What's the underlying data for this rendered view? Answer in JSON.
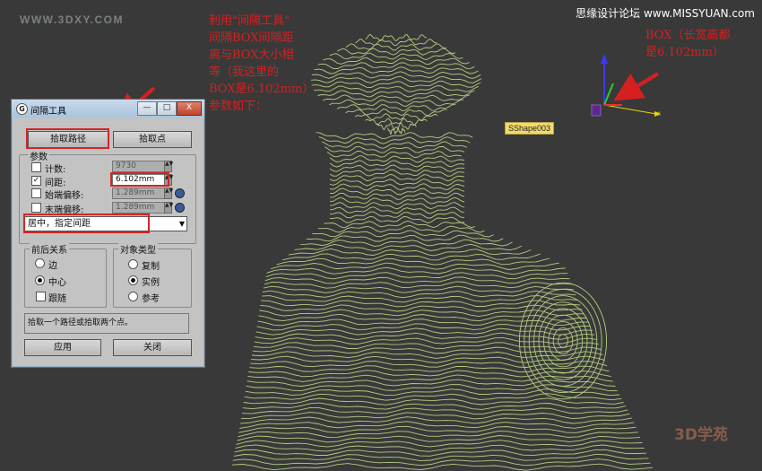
{
  "watermarks": {
    "top_left": "WWW.3DXY.COM",
    "top_right": "思缘设计论坛 www.MISSYUAN.com",
    "bottom_right": "3D学苑"
  },
  "annotations": {
    "main": "利用\"间隔工具\"\n间隔BOX间隔距\n离与BOX大小相\n等（我这里的\nBOX是6.102mm）\n参数如下：",
    "box": "BOX（长宽高都\n是6.102mm）"
  },
  "viewport": {
    "shape_label": "SShape003",
    "axis_x": "x",
    "wire_color": "#c8e68c",
    "annotation_color": "#d62020"
  },
  "dialog": {
    "title": "间隔工具",
    "window_buttons": {
      "minimize": "—",
      "maximize": "□",
      "close": "X"
    },
    "pick_path": "拾取路径",
    "pick_points": "拾取点",
    "params": {
      "group": "参数",
      "count": {
        "label": "计数:",
        "value": "9730",
        "checked": false
      },
      "spacing": {
        "label": "间距:",
        "value": "6.102mm",
        "checked": true
      },
      "start_offset": {
        "label": "始端偏移:",
        "value": "1.289mm",
        "checked": false
      },
      "end_offset": {
        "label": "末端偏移:",
        "value": "1.289mm",
        "checked": false
      },
      "mode": "居中，指定间距"
    },
    "context": {
      "group": "前后关系",
      "options": [
        "边",
        "中心"
      ],
      "selected": "中心",
      "follow": "跟随"
    },
    "object_type": {
      "group": "对象类型",
      "options": [
        "复制",
        "实例",
        "参考"
      ],
      "selected": "实例"
    },
    "status": "拾取一个路径或拾取两个点。",
    "apply": "应用",
    "close": "关闭"
  }
}
